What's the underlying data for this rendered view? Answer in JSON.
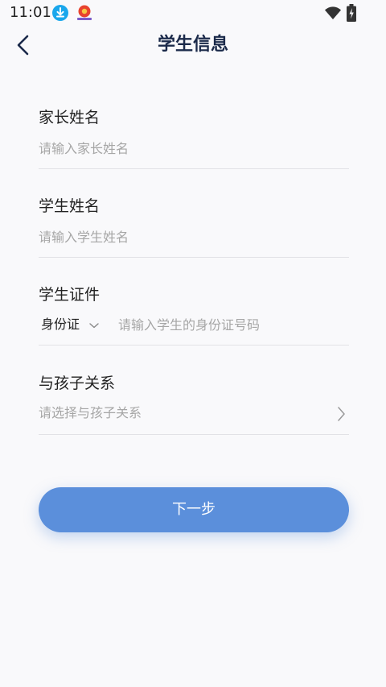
{
  "status_bar": {
    "time": "11:01"
  },
  "header": {
    "title": "学生信息"
  },
  "form": {
    "parent_name": {
      "label": "家长姓名",
      "placeholder": "请输入家长姓名"
    },
    "student_name": {
      "label": "学生姓名",
      "placeholder": "请输入学生姓名"
    },
    "student_id": {
      "label": "学生证件",
      "id_type": "身份证",
      "placeholder": "请输入学生的身份证号码"
    },
    "relationship": {
      "label": "与孩子关系",
      "placeholder": "请选择与孩子关系"
    }
  },
  "actions": {
    "next_label": "下一步"
  },
  "colors": {
    "accent": "#5b8fdb",
    "title": "#1b2a4a",
    "download_badge": "#1aa7ec"
  },
  "icons": [
    "download-icon",
    "app-notification-icon",
    "wifi-icon",
    "battery-icon",
    "back-arrow-icon",
    "chevron-down-icon",
    "chevron-right-icon"
  ]
}
